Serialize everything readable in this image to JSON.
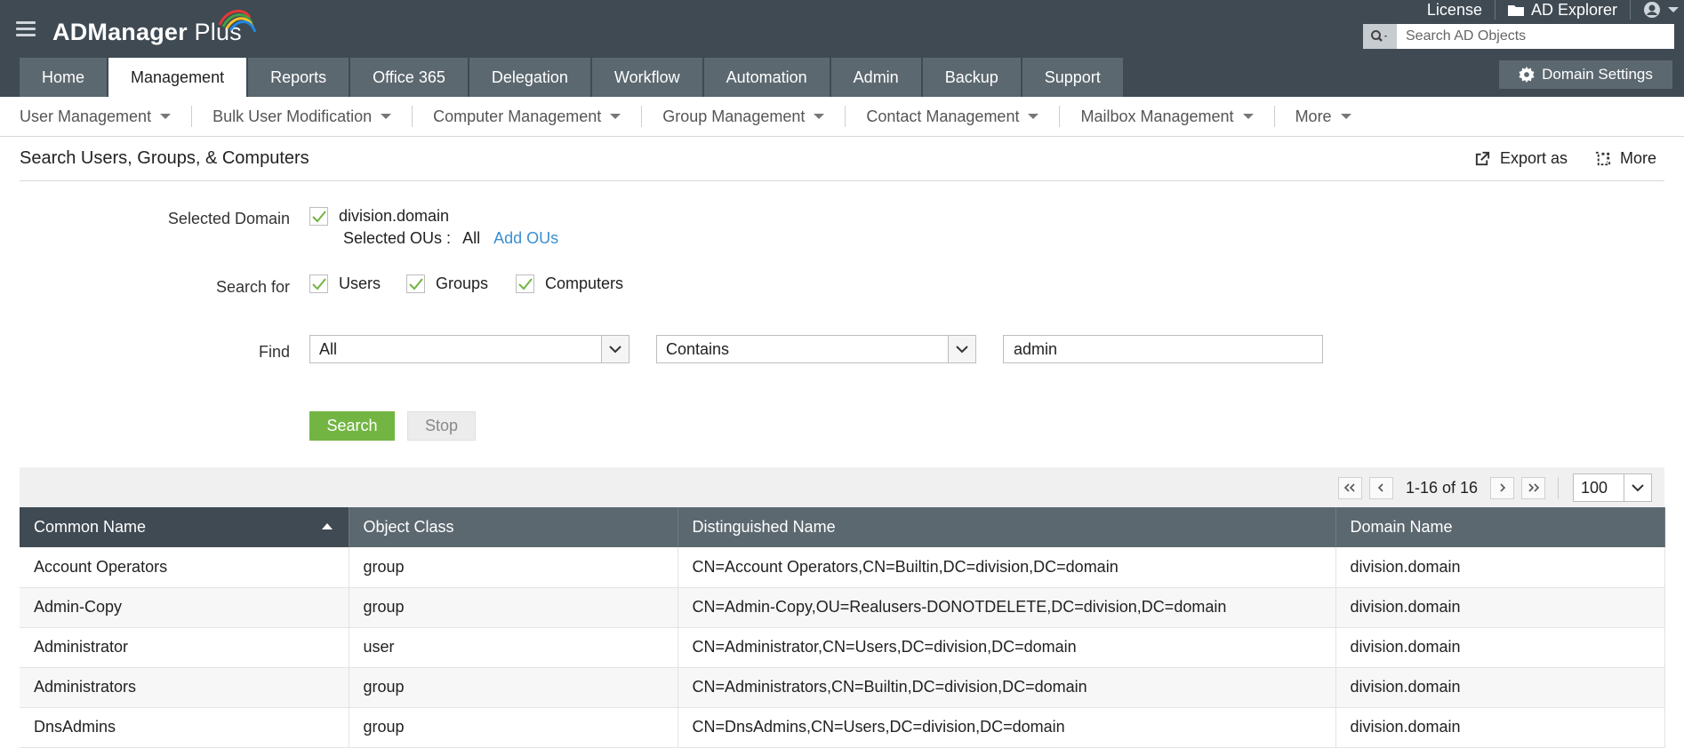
{
  "app": {
    "logo_prefix": "ADManager",
    "logo_suffix": " Plus"
  },
  "top_links": {
    "license": "License",
    "ad_explorer": "AD Explorer"
  },
  "search": {
    "placeholder": "Search AD Objects"
  },
  "tabs": [
    {
      "label": "Home"
    },
    {
      "label": "Management"
    },
    {
      "label": "Reports"
    },
    {
      "label": "Office 365"
    },
    {
      "label": "Delegation"
    },
    {
      "label": "Workflow"
    },
    {
      "label": "Automation"
    },
    {
      "label": "Admin"
    },
    {
      "label": "Backup"
    },
    {
      "label": "Support"
    }
  ],
  "active_tab": "Management",
  "domain_settings_label": "Domain Settings",
  "subnav": [
    {
      "label": "User Management"
    },
    {
      "label": "Bulk User Modification"
    },
    {
      "label": "Computer Management"
    },
    {
      "label": "Group Management"
    },
    {
      "label": "Contact Management"
    },
    {
      "label": "Mailbox Management"
    },
    {
      "label": "More"
    }
  ],
  "page": {
    "title": "Search Users, Groups, & Computers",
    "export_label": "Export as",
    "more_label": "More"
  },
  "form": {
    "selected_domain_label": "Selected Domain",
    "domain_value": "division.domain",
    "selected_ous_label": "Selected OUs :",
    "selected_ous_value": "All",
    "add_ous_link": "Add OUs",
    "search_for_label": "Search for",
    "search_for_options": [
      {
        "label": "Users",
        "checked": true
      },
      {
        "label": "Groups",
        "checked": true
      },
      {
        "label": "Computers",
        "checked": true
      }
    ],
    "find_label": "Find",
    "find_object_value": "All",
    "find_condition_value": "Contains",
    "find_text_value": "admin",
    "search_button": "Search",
    "stop_button": "Stop"
  },
  "pager": {
    "range_text": "1-16 of 16",
    "page_size": "100"
  },
  "table": {
    "columns": [
      "Common Name",
      "Object Class",
      "Distinguished Name",
      "Domain Name"
    ],
    "sorted_column": "Common Name",
    "sort_direction": "ascending",
    "rows": [
      [
        "Account Operators",
        "group",
        "CN=Account Operators,CN=Builtin,DC=division,DC=domain",
        "division.domain"
      ],
      [
        "Admin-Copy",
        "group",
        "CN=Admin-Copy,OU=Realusers-DONOTDELETE,DC=division,DC=domain",
        "division.domain"
      ],
      [
        "Administrator",
        "user",
        "CN=Administrator,CN=Users,DC=division,DC=domain",
        "division.domain"
      ],
      [
        "Administrators",
        "group",
        "CN=Administrators,CN=Builtin,DC=division,DC=domain",
        "division.domain"
      ],
      [
        "DnsAdmins",
        "group",
        "CN=DnsAdmins,CN=Users,DC=division,DC=domain",
        "division.domain"
      ]
    ]
  },
  "colors": {
    "header_bg": "#3f4a53",
    "tab_bg": "#5c6870",
    "accent_green": "#72b543",
    "link_blue": "#3a8fd0"
  },
  "icons": {
    "menu": "hamburger-icon",
    "ad_explorer": "folder-icon",
    "user": "user-avatar-icon",
    "search": "search-icon",
    "settings": "gear-icon",
    "export": "export-icon",
    "more": "more-icon"
  }
}
